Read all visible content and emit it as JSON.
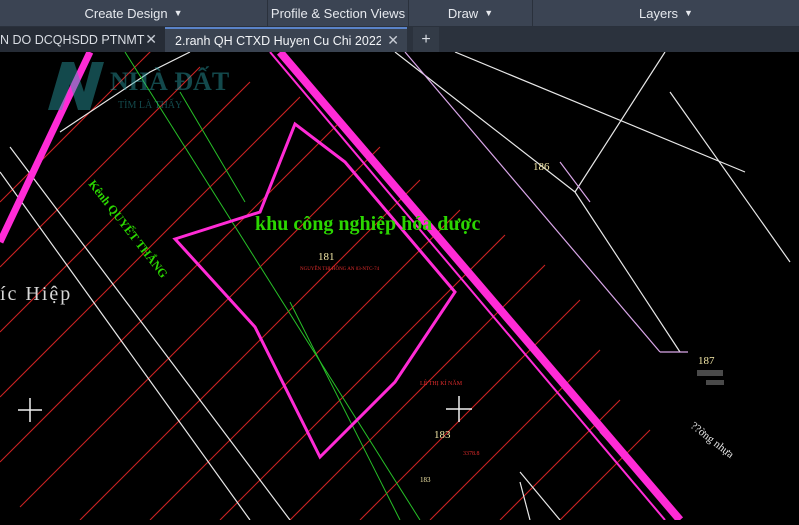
{
  "ribbon": {
    "panels": [
      {
        "label": "Create Design",
        "has_menu": true
      },
      {
        "label": "Profile & Section Views",
        "has_menu": false
      },
      {
        "label": "Draw",
        "has_menu": true
      },
      {
        "label": "Layers",
        "has_menu": true
      }
    ]
  },
  "doc_tabs": [
    {
      "label": "N DO DCQHSDD PTNMT*",
      "active": false
    },
    {
      "label": "2.ranh QH CTXD Huyen Cu Chi 2022*",
      "active": true
    }
  ],
  "new_tab_label": "+",
  "drawing": {
    "watermark_logo": "NHÀ ĐẤT",
    "watermark_sub": "TÌM LÀ THẤY",
    "zone_label": "khu công nghiệp hóa dược",
    "canal_label": "Kênh QUYẾT THẮNG",
    "place_label": "íc Hiệp",
    "parcel_numbers": [
      "181",
      "183",
      "186",
      "187",
      "183"
    ],
    "road_label": "??ờng nhựa",
    "owner_label": "LÊ THỊ KÍ NĂM",
    "area_label": "3378.8",
    "small_label_181": "NGUYỄN THỊ HỒNG AN 03-NTC-74",
    "colors": {
      "boundary": "#ff2bd6",
      "zone_text": "#2bd600",
      "parcel_text": "#f5e9a8",
      "grid": "#ff2f2f",
      "white_line": "#e8e8e8"
    }
  }
}
